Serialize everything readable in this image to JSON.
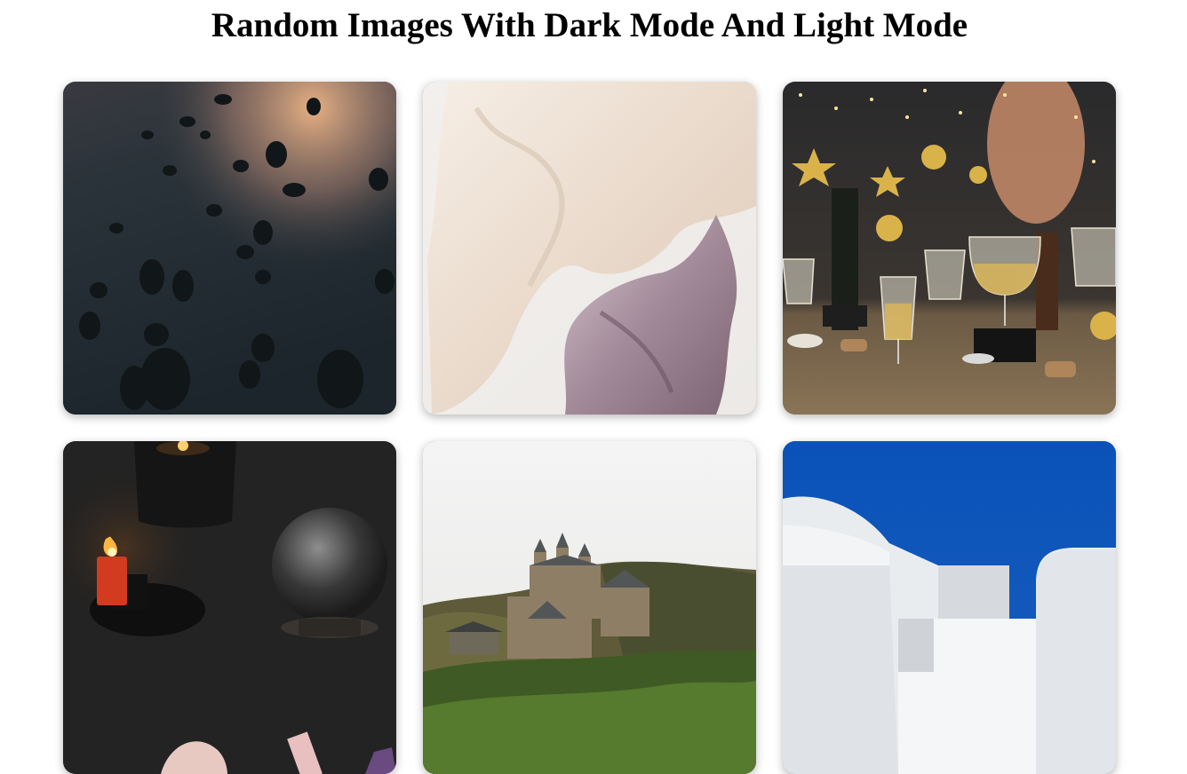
{
  "page": {
    "title": "Random Images With Dark Mode And Light Mode"
  },
  "gallery": {
    "images": [
      {
        "subject": "dark pebble beach at sunset"
      },
      {
        "subject": "flowing white and mauve fabric"
      },
      {
        "subject": "champagne glasses with gold festive decorations"
      },
      {
        "subject": "lit candles and crystal ball on dark cloth"
      },
      {
        "subject": "castle on a forested hill"
      },
      {
        "subject": "white architecture against blue sky"
      }
    ]
  },
  "colors": {
    "background": "#ffffff",
    "title": "#000000"
  }
}
